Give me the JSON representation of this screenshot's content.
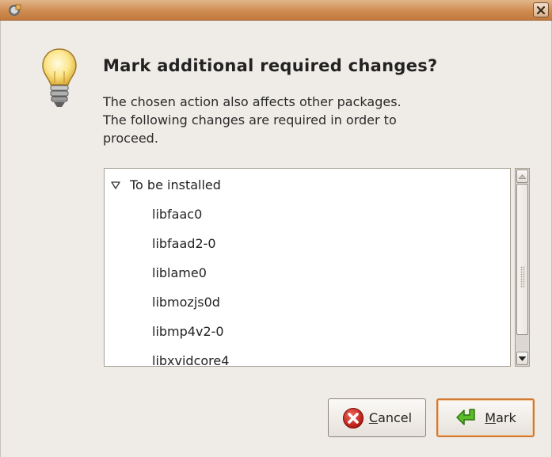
{
  "window": {
    "app_icon": "package-manager-icon",
    "close_icon": "close-icon"
  },
  "dialog": {
    "icon": "lightbulb-icon",
    "heading": "Mark additional required changes?",
    "description": [
      "The chosen action also affects other packages.",
      "The following changes are required in order to",
      "proceed."
    ]
  },
  "changes": {
    "group_label": "To be installed",
    "expander_icon": "triangle-down-icon",
    "packages": [
      "libfaac0",
      "libfaad2-0",
      "liblame0",
      "libmozjs0d",
      "libmp4v2-0",
      "libxvidcore4"
    ]
  },
  "scrollbar": {
    "up_icon": "arrow-up-icon",
    "down_icon": "arrow-down-icon"
  },
  "buttons": {
    "cancel_mnemonic": "C",
    "cancel_rest": "ancel",
    "cancel_icon": "cancel-icon",
    "mark_mnemonic": "M",
    "mark_rest": "ark",
    "mark_icon": "apply-arrow-icon"
  },
  "colors": {
    "titlebar": "#cf8c51",
    "focus_border": "#d27a34",
    "background": "#efebe7"
  }
}
